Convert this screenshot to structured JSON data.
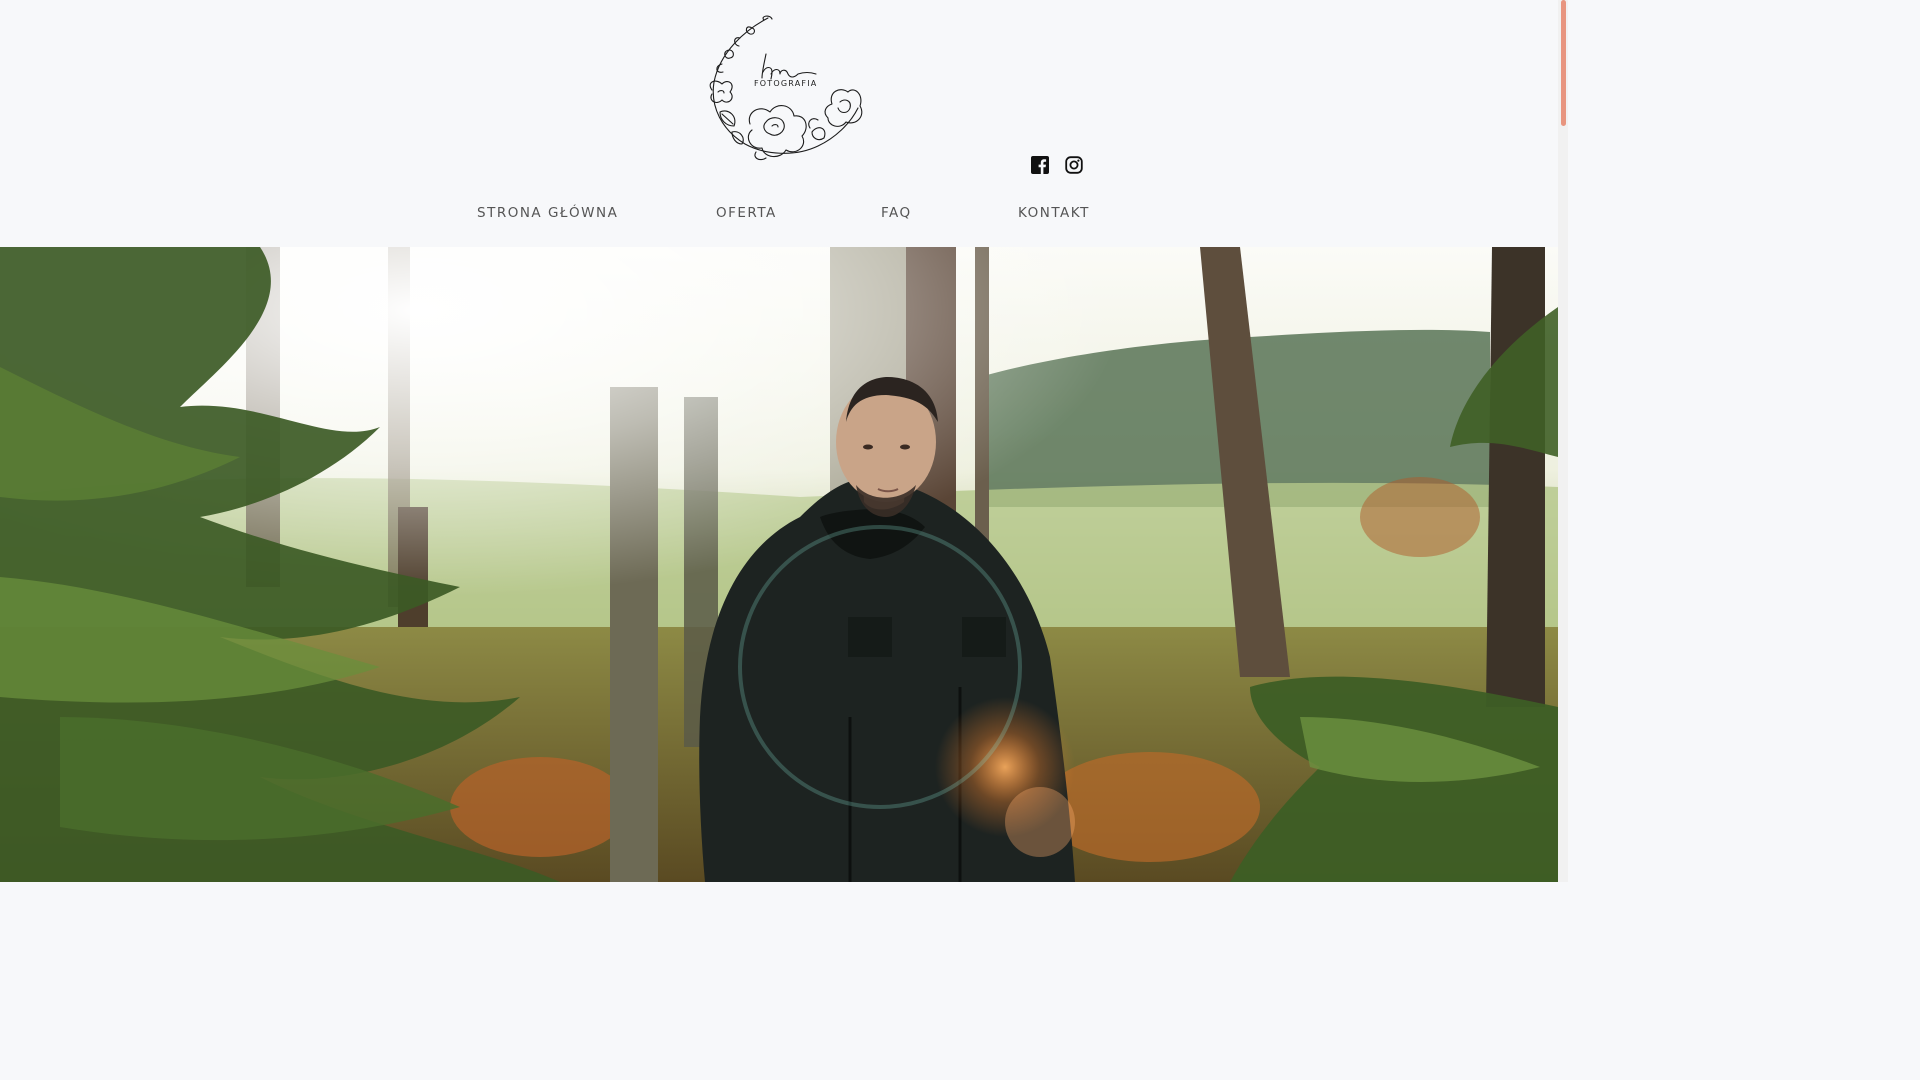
{
  "logo": {
    "monogram": "hm",
    "text": "FOTOGRAFIA"
  },
  "social": {
    "facebook": "facebook-icon",
    "instagram": "instagram-icon"
  },
  "nav": {
    "items": [
      {
        "label": "STRONA GŁÓWNA"
      },
      {
        "label": "OFERTA"
      },
      {
        "label": "FAQ"
      },
      {
        "label": "KONTAKT"
      }
    ]
  },
  "hero": {
    "image": "forest-portrait"
  },
  "colors": {
    "background": "#f7f8fa",
    "nav_text": "#555555",
    "scrollbar_thumb": "#e8957f"
  }
}
